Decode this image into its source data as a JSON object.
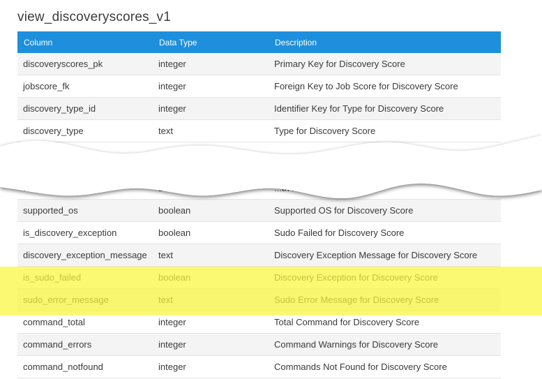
{
  "title": "view_discoveryscores_v1",
  "columns": [
    "Column",
    "Data Type",
    "Description"
  ],
  "rows_top": [
    {
      "column": "discoveryscores_pk",
      "type": "integer",
      "description": "Primary Key for Discovery Score"
    },
    {
      "column": "jobscore_fk",
      "type": "integer",
      "description": "Foreign Key to Job Score for Discovery Score"
    },
    {
      "column": "discovery_type_id",
      "type": "integer",
      "description": "Identifier Key for Type for Discovery Score"
    },
    {
      "column": "discovery_type",
      "type": "text",
      "description": "Type for Discovery Score"
    }
  ],
  "rows_partial": [
    {
      "column": "authoriz",
      "type": "boolean",
      "description": "...th for Disc"
    }
  ],
  "rows_bottom": [
    {
      "column": "supported_os",
      "type": "boolean",
      "description": "Supported OS for Discovery Score"
    },
    {
      "column": "is_discovery_exception",
      "type": "boolean",
      "description": "Sudo Failed for Discovery Score"
    },
    {
      "column": "discovery_exception_message",
      "type": "text",
      "description": "Discovery Exception Message for Discovery Score"
    },
    {
      "column": "is_sudo_failed",
      "type": "boolean",
      "description": "Discovery Exception for Discovery Score"
    },
    {
      "column": "sudo_error_message",
      "type": "text",
      "description": "Sudo Error Message for Discovery Score"
    },
    {
      "column": "command_total",
      "type": "integer",
      "description": "Total Command for Discovery Score"
    },
    {
      "column": "command_errors",
      "type": "integer",
      "description": "Command Warnings for Discovery Score"
    },
    {
      "column": "command_notfound",
      "type": "integer",
      "description": "Commands Not Found for Discovery Score"
    }
  ],
  "highlight_color": "#faf63c",
  "header_color": "#1e8fdc"
}
